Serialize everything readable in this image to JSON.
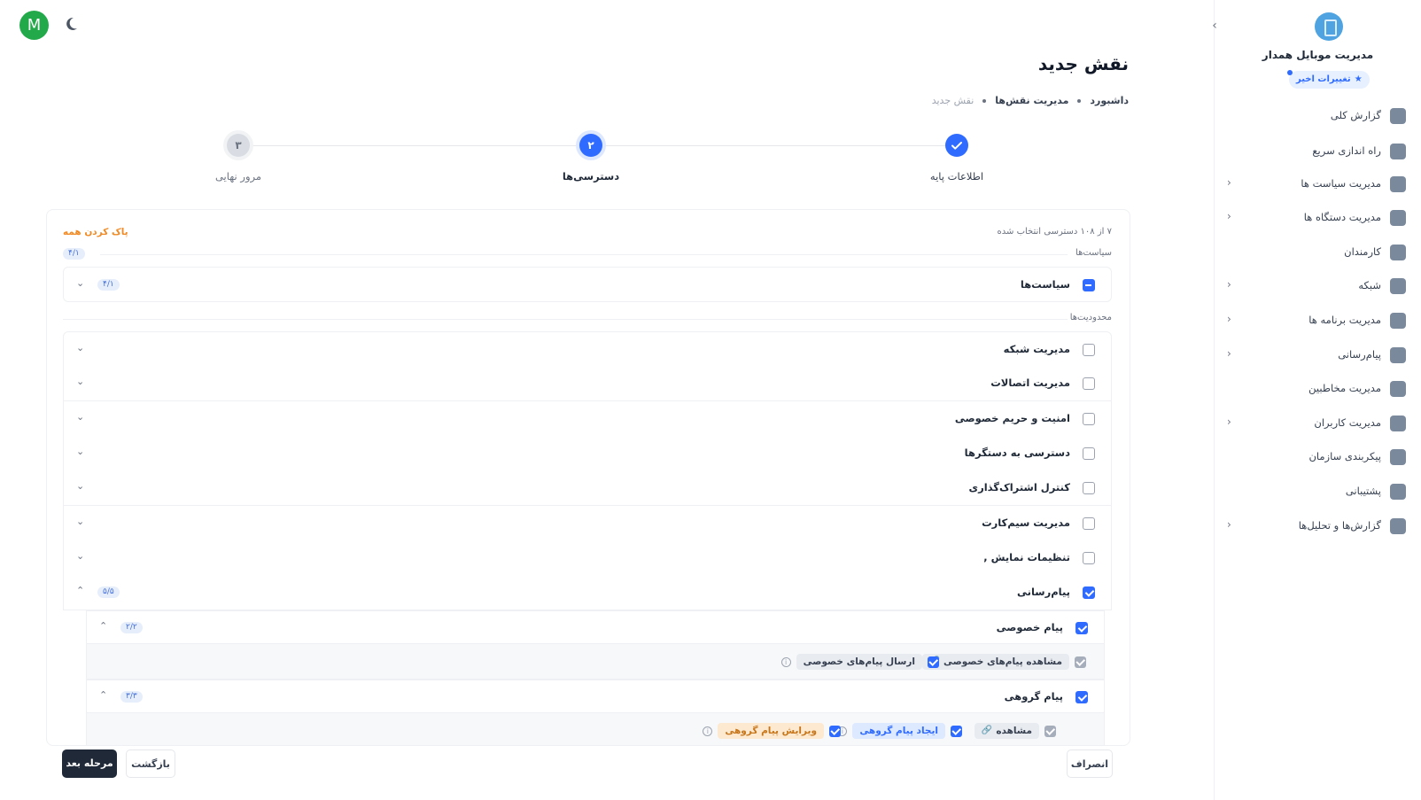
{
  "user": {
    "avatar_letter": "M"
  },
  "header": {
    "title": "نقش جدید",
    "breadcrumb": [
      "داشبورد",
      "مدیریت نقش‌ها",
      "نقش جدید"
    ]
  },
  "sidebar": {
    "title": "مدیریت موبایل همدار",
    "badge": "تغییرات اخیر",
    "items": [
      {
        "label": "گزارش کلی",
        "icon": "chart-icon",
        "has_children": false
      },
      {
        "label": "راه اندازی سریع",
        "icon": "flag-icon",
        "has_children": false
      },
      {
        "label": "مدیریت سیاست ها",
        "icon": "shield-icon",
        "has_children": true
      },
      {
        "label": "مدیریت دستگاه ها",
        "icon": "devices-icon",
        "has_children": true
      },
      {
        "label": "کارمندان",
        "icon": "users-icon",
        "has_children": false
      },
      {
        "label": "شبکه",
        "icon": "globe-icon",
        "has_children": true
      },
      {
        "label": "مدیریت برنامه ها",
        "icon": "apps-icon",
        "has_children": true
      },
      {
        "label": "پیام‌رسانی",
        "icon": "mail-icon",
        "has_children": true
      },
      {
        "label": "مدیریت مخاطبین",
        "icon": "contacts-icon",
        "has_children": false
      },
      {
        "label": "مدیریت کاربران",
        "icon": "user-icon",
        "has_children": true
      },
      {
        "label": "پیکربندی سازمان",
        "icon": "building-icon",
        "has_children": false
      },
      {
        "label": "پشتیبانی",
        "icon": "support-icon",
        "has_children": false
      },
      {
        "label": "گزارش‌ها و تحلیل‌ها",
        "icon": "analytics-icon",
        "has_children": true
      }
    ]
  },
  "stepper": {
    "steps": [
      {
        "label": "اطلاعات پایه",
        "state": "done",
        "number": ""
      },
      {
        "label": "دسترسی‌ها",
        "state": "active",
        "number": "۲"
      },
      {
        "label": "مرور نهایی",
        "state": "pending",
        "number": "۳"
      }
    ]
  },
  "permissions": {
    "selected_count": "۷ از ۱۰۸ دسترسی انتخاب شده",
    "clear_all": "پاک کردن همه",
    "policies_section": {
      "title": "سیاست‌ها",
      "badge": "۴/۱"
    },
    "policies_row": {
      "label": "سیاست‌ها",
      "badge": "۴/۱"
    },
    "restrictions_section": {
      "title": "محدودیت‌ها"
    },
    "restrictions": [
      "مدیریت شبکه",
      "مدیریت اتصالات",
      "امنیت و حریم خصوصی",
      "دسترسی به دستگرها",
      "کنترل اشتراک‌گذاری",
      "مدیریت سیم‌کارت",
      "تنظیمات نمایش ,"
    ],
    "messaging": {
      "label": "پیام‌رسانی",
      "badge": "۵/۵",
      "private": {
        "label": "پیام خصوصی",
        "badge": "۲/۲",
        "perms": [
          "مشاهده پیام‌های خصوصی",
          "ارسال پیام‌های خصوصی"
        ]
      },
      "group": {
        "label": "پیام گروهی",
        "badge": "۳/۳",
        "perms": [
          "مشاهده",
          "ایجاد پیام گروهی",
          "ویرایش پیام گروهی"
        ]
      }
    }
  },
  "footer": {
    "next": "مرحله بعد",
    "back": "بازگشت",
    "cancel": "انصراف"
  },
  "colors": {
    "accent": "#2f6bff",
    "avatar": "#22a94a",
    "warning": "#f08a24"
  }
}
